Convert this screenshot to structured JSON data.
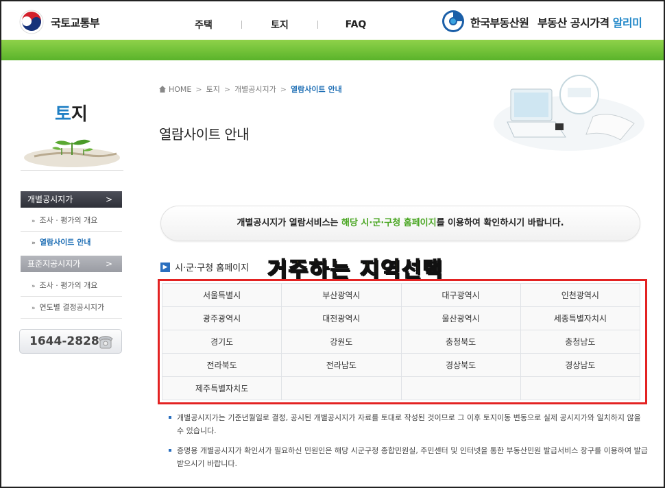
{
  "header": {
    "ministry_name": "국토교통부",
    "nav": [
      "주택",
      "토지",
      "FAQ"
    ],
    "agency_name": "한국부동산원",
    "site_name_prefix": "부동산 공시가격",
    "site_name_accent": "알리미"
  },
  "sidebar": {
    "title_first": "토",
    "title_rest": "지",
    "menus": [
      {
        "label": "개별공시지가",
        "arrow": ">",
        "items": [
          "조사 · 평가의 개요",
          "열람사이트 안내"
        ],
        "current": "열람사이트 안내"
      },
      {
        "label": "표준지공시지가",
        "arrow": ">",
        "items": [
          "조사 · 평가의 개요",
          "연도별 결정공시지가"
        ]
      }
    ],
    "bullet": "»",
    "phone": "1644-2828"
  },
  "breadcrumb": [
    "HOME",
    "토지",
    "개별공시지가",
    "열람사이트 안내"
  ],
  "breadcrumb_sep": ">",
  "page_title": "열람사이트 안내",
  "notice": {
    "before": "개별공시지가 열람서비스는 ",
    "highlight": "해당 시·군·구청 홈페이지",
    "after": "를 이용하여 확인하시기 바랍니다."
  },
  "section": {
    "icon": "▶",
    "label": "시·군·구청 홈페이지"
  },
  "annotation": "거주하는 지역선택",
  "regions": [
    [
      "서울특별시",
      "부산광역시",
      "대구광역시",
      "인천광역시"
    ],
    [
      "광주광역시",
      "대전광역시",
      "울산광역시",
      "세종특별자치시"
    ],
    [
      "경기도",
      "강원도",
      "충청북도",
      "충청남도"
    ],
    [
      "전라북도",
      "전라남도",
      "경상북도",
      "경상남도"
    ],
    [
      "제주특별자치도",
      "",
      "",
      ""
    ]
  ],
  "notes": [
    "개별공시지가는 기준년월일로 결정, 공시된 개별공시지가 자료를 토대로 작성된 것이므로 그 이후 토지이동 변동으로 실제 공시지가와 일치하지 않을 수 있습니다.",
    "증명용 개별공시지가 확인서가 필요하신 민원인은 해당 시군구청 종합민원실, 주민센터 및 인터넷을 통한 부동산민원 발급서비스 창구를 이용하여 발급 받으시기 바랍니다."
  ],
  "colors": {
    "accent_blue": "#1f86c8",
    "green": "#5ab32a",
    "highlight_red": "#e32222",
    "annotation_yellow": "#f5de12"
  },
  "icons": [
    "molit-logo",
    "reb-logo",
    "home-icon",
    "phone-icon",
    "section-arrow-icon"
  ]
}
